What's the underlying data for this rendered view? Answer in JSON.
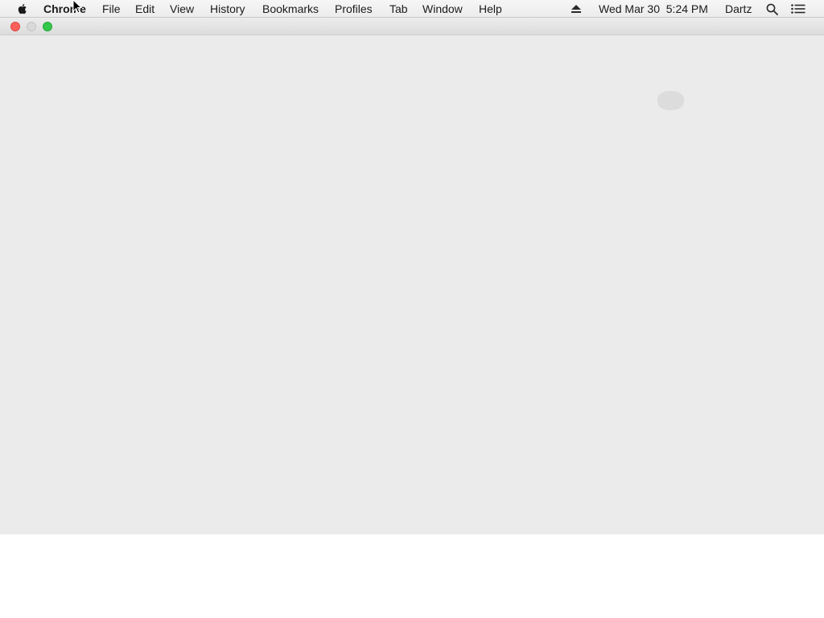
{
  "menubar": {
    "app_name": "Chrome",
    "items": [
      "File",
      "Edit",
      "View",
      "History",
      "Bookmarks",
      "Profiles",
      "Tab",
      "Window",
      "Help"
    ],
    "datetime": "Wed Mar 30  5:24 PM",
    "user": "Dartz",
    "icons": {
      "apple": "apple-logo-icon",
      "eject": "eject-icon",
      "spotlight": "search-icon",
      "notification": "notification-center-icon"
    }
  },
  "window": {
    "traffic_lights": {
      "close": "#fc605b",
      "minimize": "#d9d9d9",
      "zoom": "#34c84a"
    },
    "background": "#ebebeb"
  }
}
